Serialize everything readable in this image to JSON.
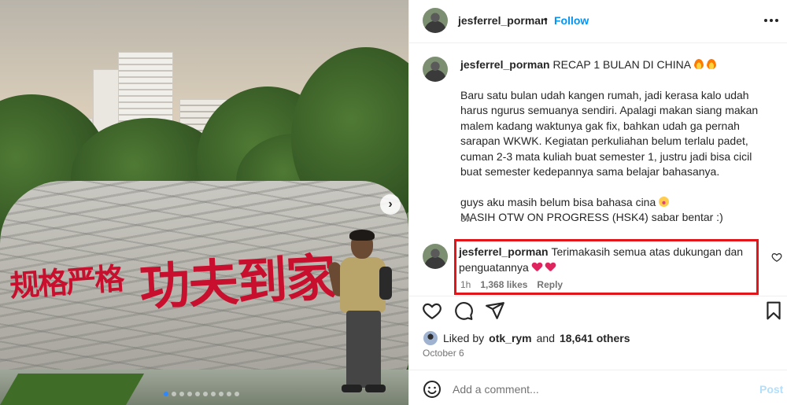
{
  "post": {
    "username": "jesferrel_porman",
    "separator": "•",
    "follow_label": "Follow",
    "more_icon": "more-horizontal-icon"
  },
  "photo": {
    "inscription_small": "规格严格",
    "inscription_big": "功夫到家",
    "next_icon": "chevron-right-icon",
    "carousel_count": 10,
    "carousel_active": 0
  },
  "caption": {
    "username": "jesferrel_porman",
    "title": "RECAP 1 BULAN DI CHINA",
    "paragraph1": "Baru satu bulan udah kangen rumah, jadi kerasa kalo udah harus ngurus semuanya sendiri. Apalagi makan siang makan malem kadang waktunya gak fix, bahkan udah ga pernah sarapan WKWK. Kegiatan perkuliahan belum terlalu padet, cuman 2-3 mata kuliah buat semester 1, justru jadi bisa cicil buat semester kedepannya sama belajar bahasanya.",
    "line2": "guys aku masih belum bisa bahasa cina",
    "line3": "MASIH OTW ON PROGRESS (HSK4) sabar bentar :)",
    "time": "3w"
  },
  "comment": {
    "username": "jesferrel_porman",
    "text": "Terimakasih semua atas dukungan dan penguatannya",
    "time": "1h",
    "likes": "1,368 likes",
    "reply": "Reply",
    "highlight_color": "#e1151a"
  },
  "likes": {
    "prefix": "Liked by",
    "user": "otk_rym",
    "joiner": "and",
    "others": "18,641 others"
  },
  "date": "October 6",
  "add_comment": {
    "placeholder": "Add a comment...",
    "post_label": "Post"
  },
  "colors": {
    "accent": "#0095f6",
    "post_disabled": "#b2dffc",
    "muted": "#737373"
  }
}
